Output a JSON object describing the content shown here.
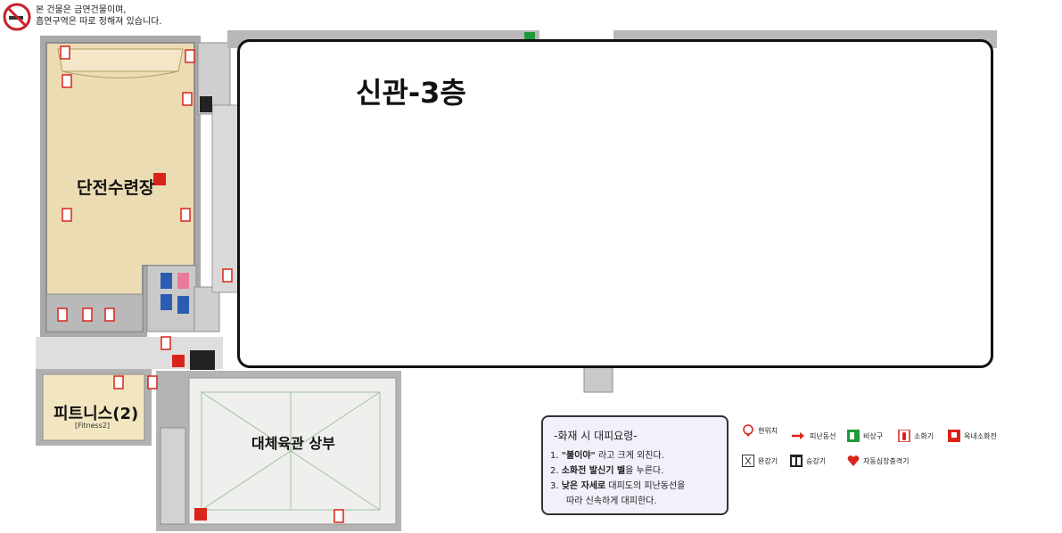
{
  "notice": {
    "line1": "본 건물은 금연건물이며,",
    "line2": "흡연구역은 따로 정해져 있습니다.",
    "icon": "no-smoking-icon"
  },
  "rooms": {
    "hall": "단전수련장",
    "fitness": "피트니스(2)",
    "fitness_en": "[Fitness2]",
    "gym_upper": "대체육관 상부"
  },
  "popup": {
    "title": "신관-3층"
  },
  "evacuation": {
    "title": "-화재 시 대피요령-",
    "step1_num": "1.",
    "step1_quote": "\"불이야\"",
    "step1_rest": "라고 크게 외친다.",
    "step2_num": "2.",
    "step2_bold": "소화전 발신기 벨",
    "step2_rest": "을 누른다.",
    "step3_num": "3.",
    "step3_bold": "낮은 자세로",
    "step3_rest": "대피도의 피난동선을",
    "step3_line2": "따라 신속하게 대피한다."
  },
  "legend": {
    "here": "현위치",
    "route": "피난동선",
    "exit": "비상구",
    "extinguisher": "소화기",
    "hydrant": "옥내소화전",
    "descender": "완강기",
    "elevator": "승강기",
    "aed": "자동심장충격기"
  },
  "colors": {
    "floor_beige": "#ecdcb4",
    "wall_gray": "#b7b7b7",
    "fire_red": "#d9241c",
    "popup_border": "#111111",
    "evac_bg": "#f1f0fb",
    "exit_green": "#1f9a3a"
  }
}
